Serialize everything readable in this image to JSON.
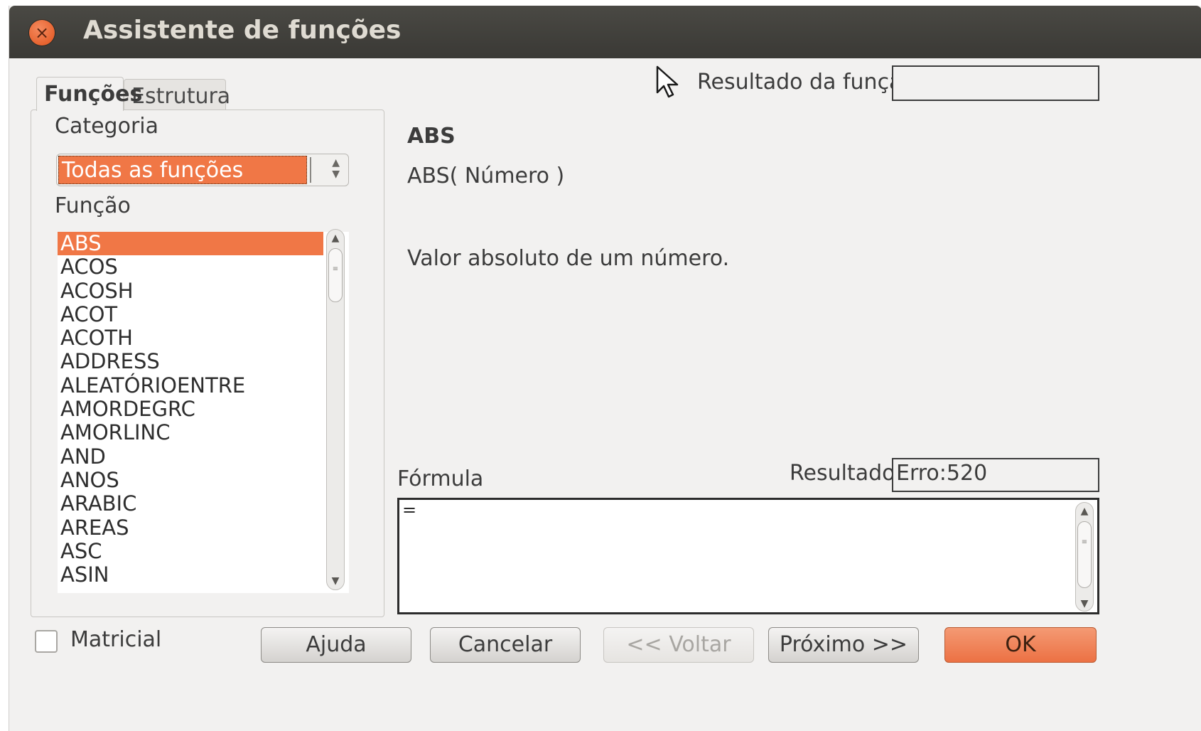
{
  "window": {
    "title": "Assistente de funções",
    "close_glyph": "×"
  },
  "tabs": [
    {
      "label": "Funções",
      "active": true
    },
    {
      "label": "Estrutura",
      "active": false
    }
  ],
  "category": {
    "label": "Categoria",
    "selected": "Todas as funções"
  },
  "function_list": {
    "label": "Função",
    "items": [
      "ABS",
      "ACOS",
      "ACOSH",
      "ACOT",
      "ACOTH",
      "ADDRESS",
      "ALEATÓRIOENTRE",
      "AMORDEGRC",
      "AMORLINC",
      "AND",
      "ANOS",
      "ARABIC",
      "AREAS",
      "ASC",
      "ASIN"
    ],
    "selected_index": 0
  },
  "function_result": {
    "label": "Resultado da função",
    "value": ""
  },
  "function_info": {
    "name": "ABS",
    "syntax": "ABS( Número )",
    "description": "Valor absoluto de um número."
  },
  "formula": {
    "label": "Fórmula",
    "result_label": "Resultado",
    "result_value": "Erro:520",
    "text": "="
  },
  "matrix": {
    "label": "Matricial",
    "checked": false
  },
  "buttons": {
    "help": "Ajuda",
    "cancel": "Cancelar",
    "back": "<< Voltar",
    "next": "Próximo >>",
    "ok": "OK"
  },
  "colors": {
    "accent": "#f07746",
    "titlebar": "#3c3b37",
    "dialog_bg": "#f2f1f0"
  },
  "icons": {
    "close": "close-icon",
    "spin": "spin-updown-icon",
    "scroll_up": "chevron-up-icon",
    "scroll_down": "chevron-down-icon",
    "cursor": "mouse-pointer-icon"
  }
}
